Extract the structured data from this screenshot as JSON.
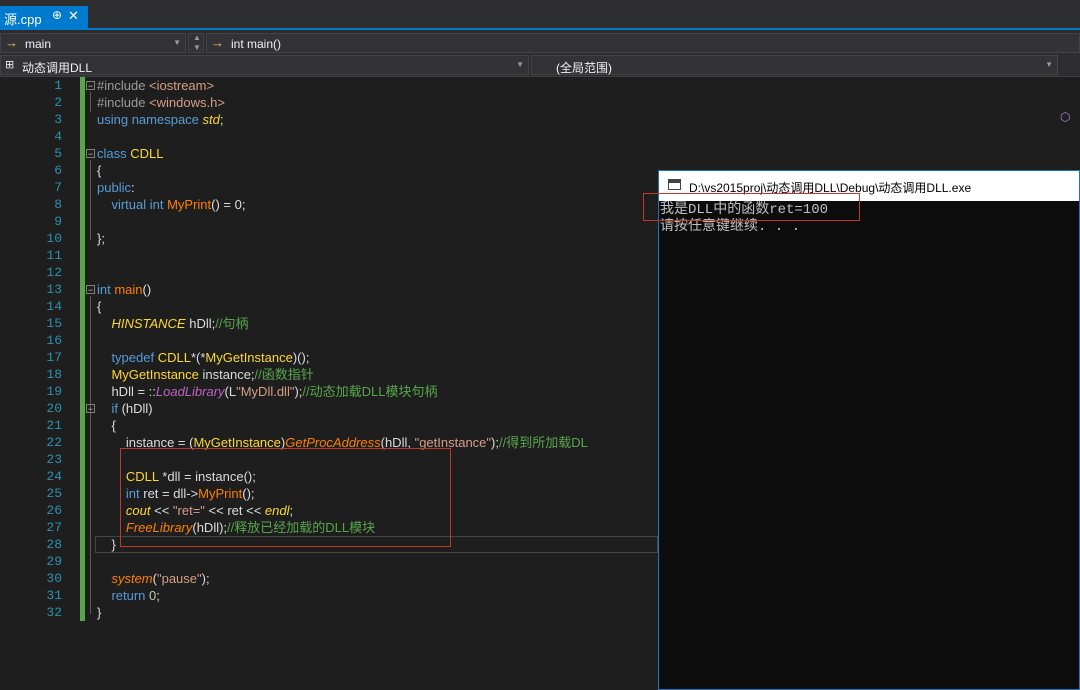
{
  "tab": {
    "filename": "源.cpp",
    "pin": "⊕",
    "close": "✕"
  },
  "nav1": {
    "scope_icon": "→",
    "scope": "main",
    "member_icon": "→",
    "member": "int main()"
  },
  "nav2": {
    "project": "动态调用DLL",
    "scope": "(全局范围)"
  },
  "line_numbers": [
    "1",
    "2",
    "3",
    "4",
    "5",
    "6",
    "7",
    "8",
    "9",
    "10",
    "11",
    "12",
    "13",
    "14",
    "15",
    "16",
    "17",
    "18",
    "19",
    "20",
    "21",
    "22",
    "23",
    "24",
    "25",
    "26",
    "27",
    "28",
    "29",
    "30",
    "31",
    "32"
  ],
  "code": {
    "l1_a": "#include ",
    "l1_b": "<iostream>",
    "l2_a": "#include ",
    "l2_b": "<windows.h>",
    "l3_a": "using namespace ",
    "l3_b": "std",
    "l3_c": ";",
    "l5_a": "class ",
    "l5_b": "CDLL",
    "l6": "{",
    "l7_a": "public",
    "l7_b": ":",
    "l8_a": "    virtual int ",
    "l8_b": "MyPrint",
    "l8_c": "() = 0;",
    "l10": "};",
    "l13_a": "int ",
    "l13_b": "main",
    "l13_c": "()",
    "l14": "{",
    "l15_a": "    ",
    "l15_b": "HINSTANCE",
    "l15_c": " hDll;",
    "l15_d": "//句柄",
    "l17_a": "    typedef ",
    "l17_b": "CDLL",
    "l17_c": "*(*",
    "l17_d": "MyGetInstance",
    "l17_e": ")();",
    "l18_a": "    ",
    "l18_b": "MyGetInstance",
    "l18_c": " instance;",
    "l18_d": "//函数指针",
    "l19_a": "    hDll = ::",
    "l19_b": "LoadLibrary",
    "l19_c": "(L",
    "l19_d": "\"MyDll.dll\"",
    "l19_e": ");",
    "l19_f": "//动态加载DLL模块句柄",
    "l20_a": "    if ",
    "l20_b": "(hDll)",
    "l21": "    {",
    "l22_a": "        instance = (",
    "l22_b": "MyGetInstance",
    "l22_c": ")",
    "l22_d": "GetProcAddress",
    "l22_e": "(hDll, ",
    "l22_f": "\"getInstance\"",
    "l22_g": ");",
    "l22_h": "//得到所加载DL",
    "l24_a": "        ",
    "l24_b": "CDLL",
    "l24_c": " *dll = instance();",
    "l25_a": "        int ",
    "l25_b": "ret = dll->",
    "l25_c": "MyPrint",
    "l25_d": "();",
    "l26_a": "        ",
    "l26_b": "cout",
    "l26_c": " << ",
    "l26_d": "\"ret=\"",
    "l26_e": " << ret << ",
    "l26_f": "endl",
    "l26_g": ";",
    "l27_a": "        ",
    "l27_b": "FreeLibrary",
    "l27_c": "(hDll);",
    "l27_d": "//释放已经加载的DLL模块",
    "l28": "    }",
    "l30_a": "    ",
    "l30_b": "system",
    "l30_c": "(",
    "l30_d": "\"pause\"",
    "l30_e": ");",
    "l31_a": "    return ",
    "l31_b": "0",
    "l31_c": ";",
    "l32": "}"
  },
  "console": {
    "title": "D:\\vs2015proj\\动态调用DLL\\Debug\\动态调用DLL.exe",
    "line1": "我是DLL中的函数ret=100",
    "line2": "请按任意键继续. . ."
  },
  "colors": {
    "accent": "#007acc",
    "keyword": "#569cd6",
    "type": "#fdd835",
    "comment": "#57a64a",
    "string": "#d69d85",
    "annotation": "#c0392b"
  }
}
